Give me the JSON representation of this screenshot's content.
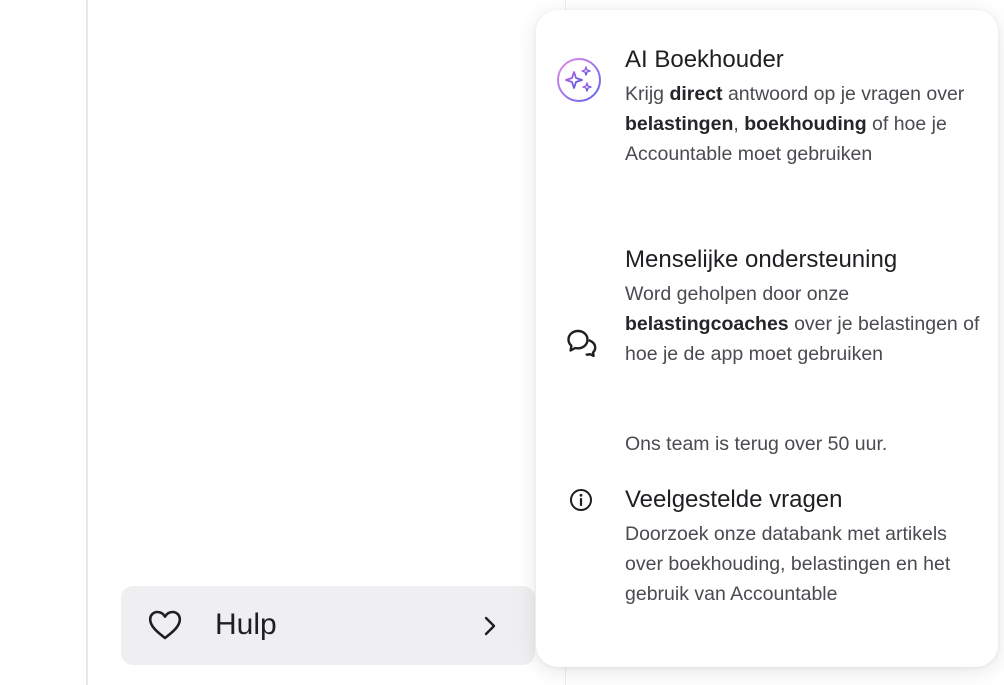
{
  "sidebar": {
    "help_button": {
      "label": "Hulp",
      "icon": "heart-icon",
      "chevron_icon": "chevron-right-icon"
    }
  },
  "help_menu": {
    "options": [
      {
        "id": "ai",
        "icon": "ai-sparkle-icon",
        "title": "AI Boekhouder",
        "description_parts": [
          {
            "text": "Krijg ",
            "bold": false
          },
          {
            "text": "direct",
            "bold": true
          },
          {
            "text": " antwoord op je vragen over ",
            "bold": false
          },
          {
            "text": "belastingen",
            "bold": true
          },
          {
            "text": ", ",
            "bold": false
          },
          {
            "text": "boekhouding",
            "bold": true
          },
          {
            "text": " of hoe je Accountable moet gebruiken",
            "bold": false
          }
        ]
      },
      {
        "id": "human",
        "icon": "chat-bubbles-icon",
        "title": "Menselijke ondersteuning",
        "description_parts": [
          {
            "text": "Word geholpen door onze ",
            "bold": false
          },
          {
            "text": "belastingcoaches",
            "bold": true
          },
          {
            "text": " over je belastingen of hoe je de app moet gebruiken",
            "bold": false
          }
        ],
        "note": "Ons team is terug over 50 uur."
      },
      {
        "id": "faq",
        "icon": "info-icon",
        "title": "Veelgestelde vragen",
        "description_parts": [
          {
            "text": "Doorzoek onze databank met artikels over boekhouding, belastingen en het gebruik van Accountable",
            "bold": false
          }
        ]
      }
    ]
  },
  "colors": {
    "help_button_bg": "#efeff1",
    "text_primary": "#1f1f23",
    "text_secondary": "#4a4a50",
    "ai_gradient_start": "#e58ae6",
    "ai_gradient_end": "#5b63f0"
  }
}
